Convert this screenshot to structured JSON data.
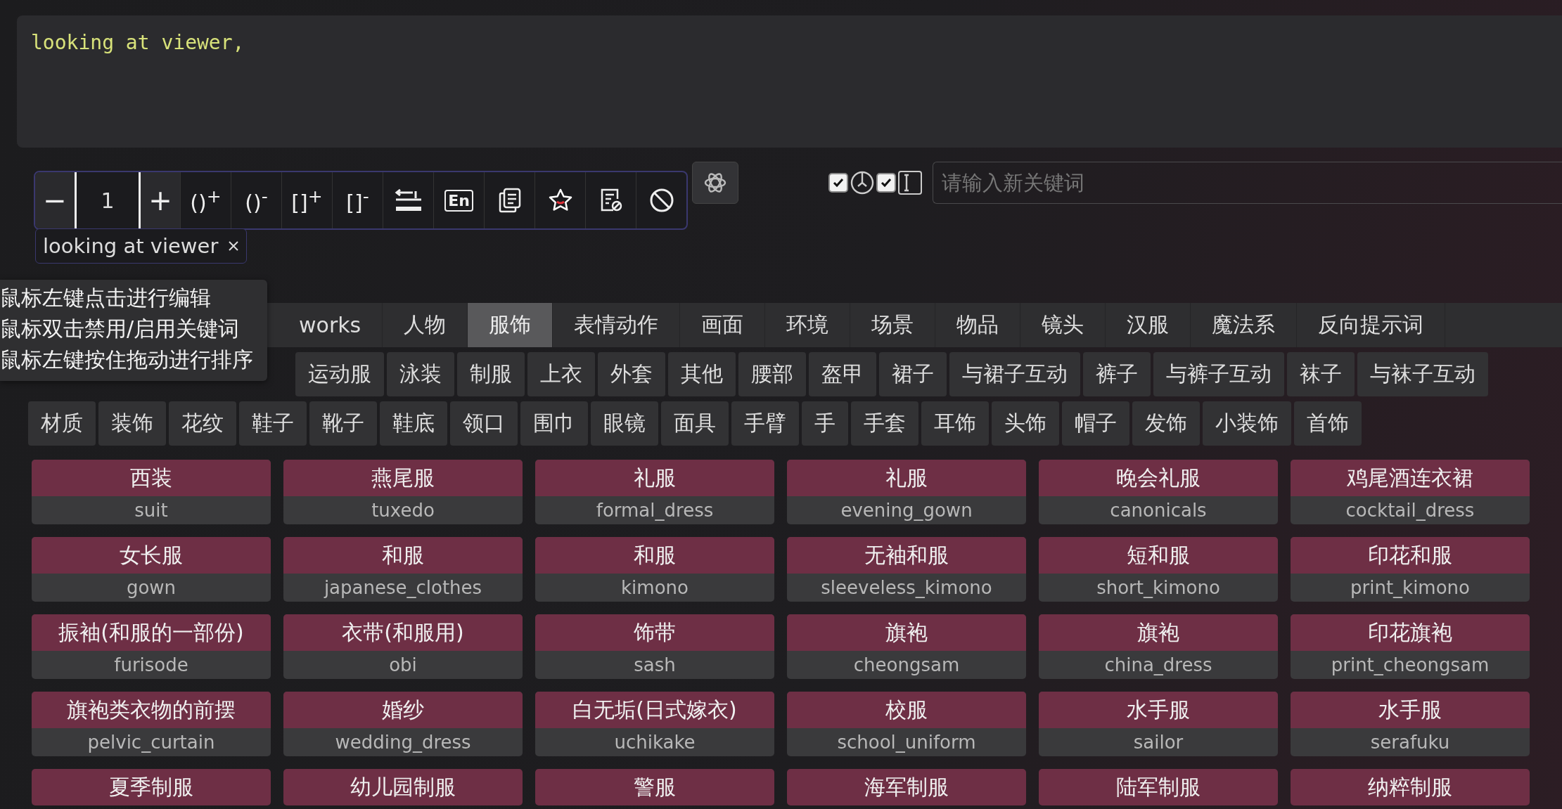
{
  "prompt_text": "looking at viewer,",
  "toolbar": [
    {
      "kind": "text",
      "label": "−"
    },
    {
      "kind": "weight",
      "value": "1"
    },
    {
      "kind": "text",
      "label": "+"
    },
    {
      "kind": "text",
      "label": "()$^{+}$"
    },
    {
      "kind": "text",
      "label": "()$^{-}$"
    },
    {
      "kind": "text",
      "label": "[]$^{+}$"
    },
    {
      "kind": "text",
      "label": "[]$^{-}$"
    },
    {
      "kind": "wrap"
    },
    {
      "kind": "lang",
      "label": "En"
    },
    {
      "kind": "copy"
    },
    {
      "kind": "star"
    },
    {
      "kind": "note"
    },
    {
      "kind": "ban"
    }
  ],
  "options": [
    {
      "kind": "checkbox",
      "checked": true
    },
    {
      "kind": "clock"
    },
    {
      "kind": "checkbox",
      "checked": true
    },
    {
      "kind": "cursor"
    }
  ],
  "keyword_input": {
    "placeholder": "请输入新关键词"
  },
  "tags": [
    {
      "text": "looking at viewer"
    }
  ],
  "tooltip": [
    "鼠标左键点击进行编辑",
    "鼠标双击禁用/启用关键词",
    "鼠标左键按住拖动进行排序"
  ],
  "category_tabs": [
    {
      "label": "works",
      "selected": false
    },
    {
      "label": "人物",
      "selected": false
    },
    {
      "label": "服饰",
      "selected": true
    },
    {
      "label": "表情动作",
      "selected": false
    },
    {
      "label": "画面",
      "selected": false
    },
    {
      "label": "环境",
      "selected": false
    },
    {
      "label": "场景",
      "selected": false
    },
    {
      "label": "物品",
      "selected": false
    },
    {
      "label": "镜头",
      "selected": false
    },
    {
      "label": "汉服",
      "selected": false
    },
    {
      "label": "魔法系",
      "selected": false
    },
    {
      "label": "反向提示词",
      "selected": false
    }
  ],
  "subcategory_tabs": [
    {
      "label": "运动服",
      "selected": false
    },
    {
      "label": "泳装",
      "selected": false
    },
    {
      "label": "制服",
      "selected": false
    },
    {
      "label": "上衣",
      "selected": false
    },
    {
      "label": "外套",
      "selected": false
    },
    {
      "label": "其他",
      "selected": false
    },
    {
      "label": "腰部",
      "selected": false
    },
    {
      "label": "盔甲",
      "selected": false
    },
    {
      "label": "裙子",
      "selected": false
    },
    {
      "label": "与裙子互动",
      "selected": false
    },
    {
      "label": "裤子",
      "selected": false
    },
    {
      "label": "与裤子互动",
      "selected": false
    },
    {
      "label": "袜子",
      "selected": false
    },
    {
      "label": "与袜子互动",
      "selected": false
    }
  ],
  "detail_tabs": [
    {
      "label": "材质",
      "selected": false
    },
    {
      "label": "装饰",
      "selected": false
    },
    {
      "label": "花纹",
      "selected": false
    },
    {
      "label": "鞋子",
      "selected": false
    },
    {
      "label": "靴子",
      "selected": false
    },
    {
      "label": "鞋底",
      "selected": false
    },
    {
      "label": "领口",
      "selected": false
    },
    {
      "label": "围巾",
      "selected": false
    },
    {
      "label": "眼镜",
      "selected": false
    },
    {
      "label": "面具",
      "selected": false
    },
    {
      "label": "手臂",
      "selected": false
    },
    {
      "label": "手",
      "selected": false
    },
    {
      "label": "手套",
      "selected": false
    },
    {
      "label": "耳饰",
      "selected": false
    },
    {
      "label": "头饰",
      "selected": false
    },
    {
      "label": "帽子",
      "selected": false
    },
    {
      "label": "发饰",
      "selected": false
    },
    {
      "label": "小装饰",
      "selected": false
    },
    {
      "label": "首饰",
      "selected": false
    }
  ],
  "keywords": [
    {
      "zh": "西装",
      "en": "suit"
    },
    {
      "zh": "燕尾服",
      "en": "tuxedo"
    },
    {
      "zh": "礼服",
      "en": "formal_dress"
    },
    {
      "zh": "礼服",
      "en": "evening_gown"
    },
    {
      "zh": "晚会礼服",
      "en": "canonicals"
    },
    {
      "zh": "鸡尾酒连衣裙",
      "en": "cocktail_dress"
    },
    {
      "zh": "女长服",
      "en": "gown"
    },
    {
      "zh": "和服",
      "en": "japanese_clothes"
    },
    {
      "zh": "和服",
      "en": "kimono"
    },
    {
      "zh": "无袖和服",
      "en": "sleeveless_kimono"
    },
    {
      "zh": "短和服",
      "en": "short_kimono"
    },
    {
      "zh": "印花和服",
      "en": "print_kimono"
    },
    {
      "zh": "振袖(和服的一部份)",
      "en": "furisode"
    },
    {
      "zh": "衣带(和服用)",
      "en": "obi"
    },
    {
      "zh": "饰带",
      "en": "sash"
    },
    {
      "zh": "旗袍",
      "en": "cheongsam"
    },
    {
      "zh": "旗袍",
      "en": "china_dress"
    },
    {
      "zh": "印花旗袍",
      "en": "print_cheongsam"
    },
    {
      "zh": "旗袍类衣物的前摆",
      "en": "pelvic_curtain"
    },
    {
      "zh": "婚纱",
      "en": "wedding_dress"
    },
    {
      "zh": "白无垢(日式嫁衣)",
      "en": "uchikake"
    },
    {
      "zh": "校服",
      "en": "school_uniform"
    },
    {
      "zh": "水手服",
      "en": "sailor"
    },
    {
      "zh": "水手服",
      "en": "serafuku"
    },
    {
      "zh": "夏季制服"
    },
    {
      "zh": "幼儿园制服"
    },
    {
      "zh": "警服"
    },
    {
      "zh": "海军制服"
    },
    {
      "zh": "陆军制服"
    },
    {
      "zh": "纳粹制服"
    }
  ]
}
